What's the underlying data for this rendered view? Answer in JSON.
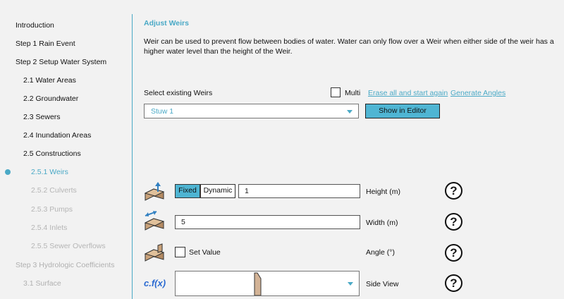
{
  "sidebar": {
    "items": [
      {
        "label": "Introduction"
      },
      {
        "label": "Step 1 Rain Event"
      },
      {
        "label": "Step 2 Setup Water System"
      },
      {
        "label": "2.1 Water Areas"
      },
      {
        "label": "2.2 Groundwater"
      },
      {
        "label": "2.3 Sewers"
      },
      {
        "label": "2.4 Inundation Areas"
      },
      {
        "label": "2.5 Constructions"
      },
      {
        "label": "2.5.1 Weirs"
      },
      {
        "label": "2.5.2 Culverts"
      },
      {
        "label": "2.5.3 Pumps"
      },
      {
        "label": "2.5.4 Inlets"
      },
      {
        "label": "2.5.5 Sewer Overflows"
      },
      {
        "label": "Step 3 Hydrologic Coefficients"
      },
      {
        "label": "3.1 Surface"
      }
    ],
    "active_color": "#4aa9c6"
  },
  "main": {
    "title": "Adjust Weirs",
    "description": "Weir can be used to prevent flow between bodies of water. Water can only flow over a Weir when either side of the weir has a higher water level than the height of the Weir.",
    "select_label": "Select existing Weirs",
    "multi_label": "Multi",
    "erase_link": "Erase all and start again",
    "generate_link": "Generate Angles",
    "weir_selected": "Stuw 1",
    "show_editor_button": "Show in Editor",
    "height": {
      "fixed_label": "Fixed",
      "dynamic_label": "Dynamic",
      "value": "1",
      "label": "Height (m)",
      "icon": "weir-height-icon"
    },
    "width": {
      "value": "5",
      "label": "Width (m)",
      "icon": "weir-width-icon"
    },
    "angle": {
      "set_value_label": "Set Value",
      "label": "Angle (°)",
      "icon": "weir-angle-icon"
    },
    "side_view": {
      "function_label": "c.f(x)",
      "label": "Side View"
    },
    "help_glyph": "?"
  }
}
